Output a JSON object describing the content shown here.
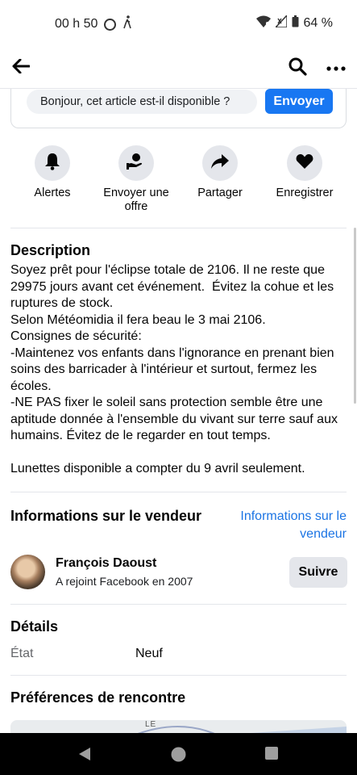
{
  "status_bar": {
    "time": "00 h 50",
    "battery": "64 %"
  },
  "topbar": {
    "back_icon": "arrow-left-icon",
    "search_icon": "search-icon",
    "more_icon": "more-horizontal-icon"
  },
  "message": {
    "input_value": "Bonjour, cet article est-il disponible ?",
    "send_label": "Envoyer"
  },
  "actions": [
    {
      "label": "Alertes",
      "icon": "bell-icon"
    },
    {
      "label": "Envoyer une offre",
      "icon": "offer-icon"
    },
    {
      "label": "Partager",
      "icon": "share-icon"
    },
    {
      "label": "Enregistrer",
      "icon": "heart-icon"
    }
  ],
  "description": {
    "title": "Description",
    "text": "Soyez prêt pour l'éclipse totale de 2106. Il ne reste que 29975 jours avant cet événement.  Évitez la cohue et les ruptures de stock.\nSelon Météomidia il fera beau le 3 mai 2106.\nConsignes de sécurité:\n-Maintenez vos enfants dans l'ignorance en prenant bien soins des barricader à l'intérieur et surtout, fermez les écoles.\n-NE PAS fixer le soleil sans protection semble être une aptitude donnée à l'ensemble du vivant sur terre sauf aux humains. Évitez de le regarder en tout temps.\n\nLunettes disponible a compter du 9 avril seulement."
  },
  "seller": {
    "title": "Informations sur le vendeur",
    "link": "Informations sur le vendeur",
    "name": "François Daoust",
    "joined": "A rejoint Facebook en 2007",
    "follow_label": "Suivre"
  },
  "details": {
    "title": "Détails",
    "condition_key": "État",
    "condition_value": "Neuf"
  },
  "meeting": {
    "title": "Préférences de rencontre",
    "map_label": "LE"
  },
  "colors": {
    "accent": "#1877f2",
    "link": "#1b74e4",
    "chip": "#e4e6eb"
  }
}
